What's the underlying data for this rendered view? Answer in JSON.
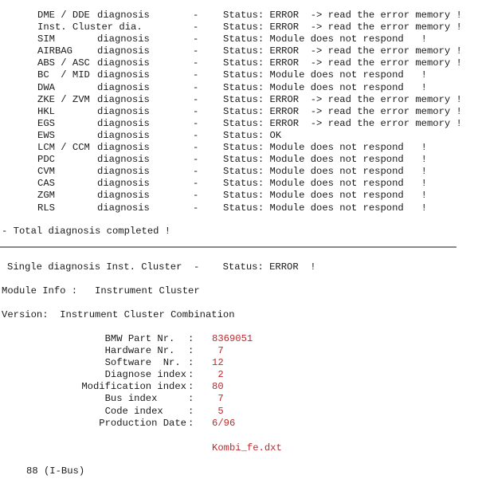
{
  "diagnosis_list": [
    {
      "module": "DME / DDE",
      "word": "diagnosis",
      "status": "Status: ERROR  -> read the error memory !"
    },
    {
      "module": "Inst. Cluster dia.",
      "word": "",
      "status": "Status: ERROR  -> read the error memory !"
    },
    {
      "module": "SIM",
      "word": "diagnosis",
      "status": "Status: Module does not respond   !"
    },
    {
      "module": "AIRBAG",
      "word": "diagnosis",
      "status": "Status: ERROR  -> read the error memory !"
    },
    {
      "module": "ABS / ASC",
      "word": "diagnosis",
      "status": "Status: ERROR  -> read the error memory !"
    },
    {
      "module": "BC  / MID",
      "word": "diagnosis",
      "status": "Status: Module does not respond   !"
    },
    {
      "module": "DWA",
      "word": "diagnosis",
      "status": "Status: Module does not respond   !"
    },
    {
      "module": "ZKE / ZVM",
      "word": "diagnosis",
      "status": "Status: ERROR  -> read the error memory !"
    },
    {
      "module": "HKL",
      "word": "diagnosis",
      "status": "Status: ERROR  -> read the error memory !"
    },
    {
      "module": "EGS",
      "word": "diagnosis",
      "status": "Status: ERROR  -> read the error memory !"
    },
    {
      "module": "EWS",
      "word": "diagnosis",
      "status": "Status: OK"
    },
    {
      "module": "LCM / CCM",
      "word": "diagnosis",
      "status": "Status: Module does not respond   !"
    },
    {
      "module": "PDC",
      "word": "diagnosis",
      "status": "Status: Module does not respond   !"
    },
    {
      "module": "CVM",
      "word": "diagnosis",
      "status": "Status: Module does not respond   !"
    },
    {
      "module": "CAS",
      "word": "diagnosis",
      "status": "Status: Module does not respond   !"
    },
    {
      "module": "ZGM",
      "word": "diagnosis",
      "status": "Status: Module does not respond   !"
    },
    {
      "module": "RLS",
      "word": "diagnosis",
      "status": "Status: Module does not respond   !"
    }
  ],
  "dash": "-",
  "total_message": "- Total diagnosis completed !",
  "single_diagnosis": "Single diagnosis Inst. Cluster  -    Status: ERROR  !",
  "module_info": "Module Info :   Instrument Cluster",
  "version": "Version:  Instrument Cluster Combination",
  "info_rows": [
    {
      "label": "BMW Part Nr.  ",
      "value": "8369051"
    },
    {
      "label": "Hardware Nr.  ",
      "value": " 7"
    },
    {
      "label": "Software  Nr. ",
      "value": "12"
    },
    {
      "label": "Diagnose index",
      "value": " 2"
    },
    {
      "label": "Modification index",
      "value": "80"
    },
    {
      "label": "Bus index     ",
      "value": " 7"
    },
    {
      "label": "Code index    ",
      "value": " 5"
    },
    {
      "label": "Production Date",
      "value": "6/96"
    }
  ],
  "colon": ":",
  "file_name": "Kombi_fe.dxt",
  "bus_info": "88 (I-Bus)",
  "colors": {
    "value_red": "#c0282c",
    "text": "#1a1a1a",
    "divider": "#8a8a8a"
  }
}
